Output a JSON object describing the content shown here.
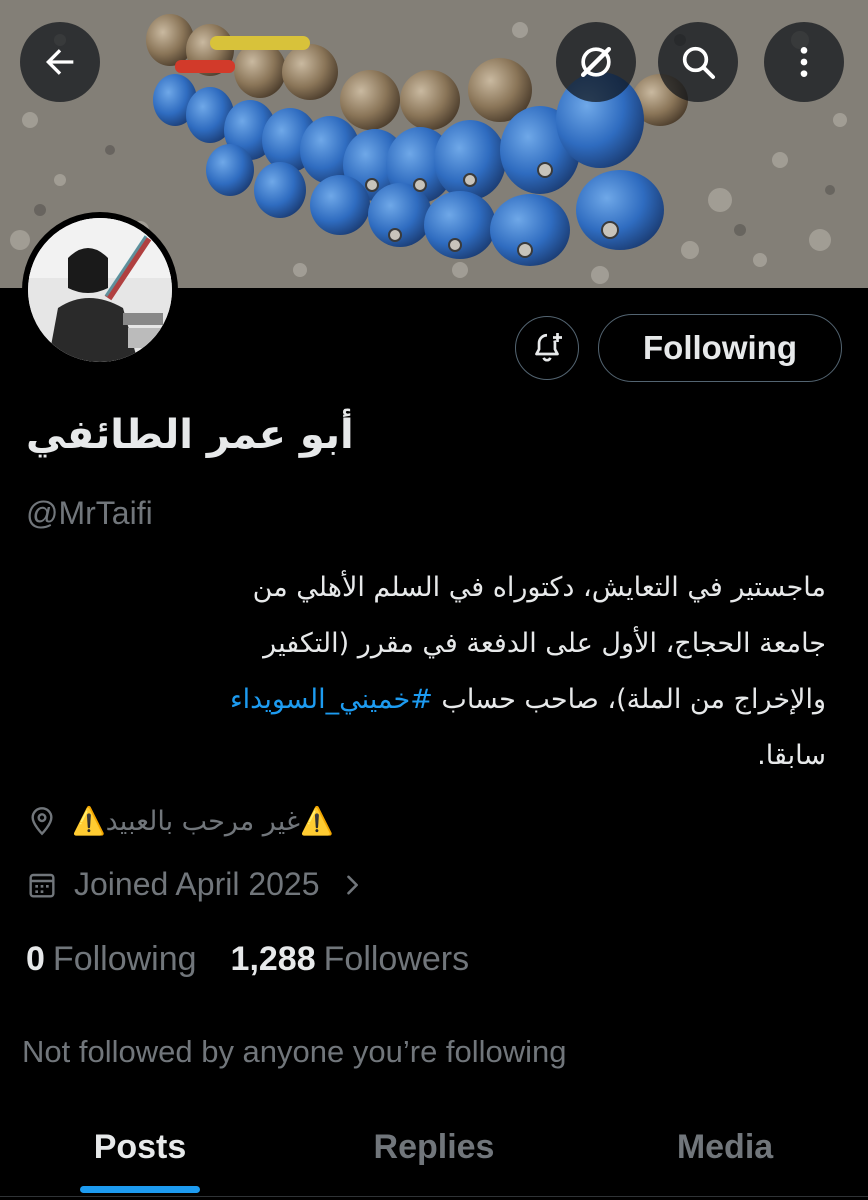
{
  "profile": {
    "display_name": "أبو عمر الطائفي",
    "handle": "@MrTaifi",
    "bio_lines": [
      "ماجستير في التعايش، دكتوراه في السلم الأهلي من",
      "جامعة الحجاج، الأول على الدفعة في مقرر (التكفير",
      "والإخراج من الملة)، صاحب حساب ",
      "سابقا."
    ],
    "bio_hashtag": "#خميني_السويداء",
    "location": "⚠️غير مرحب بالعبيد⚠️",
    "joined": "Joined April 2025",
    "following_count": "0",
    "following_label": "Following",
    "followers_count": "1,288",
    "followers_label": "Followers",
    "not_followed_text": "Not followed by anyone you’re following"
  },
  "actions": {
    "following_button": "Following"
  },
  "tabs": [
    {
      "label": "Posts",
      "active": true
    },
    {
      "label": "Replies",
      "active": false
    },
    {
      "label": "Media",
      "active": false
    }
  ],
  "icons": {
    "back": "back-arrow-icon",
    "grok": "grok-icon",
    "search": "search-icon",
    "more": "more-icon",
    "bell": "notification-bell-plus-icon",
    "location": "location-pin-icon",
    "calendar": "calendar-icon",
    "chevron": "chevron-right-icon"
  },
  "colors": {
    "background": "#000000",
    "text": "#e7e9ea",
    "muted": "#71767b",
    "accent": "#1d9bf0",
    "border": "#536471"
  }
}
